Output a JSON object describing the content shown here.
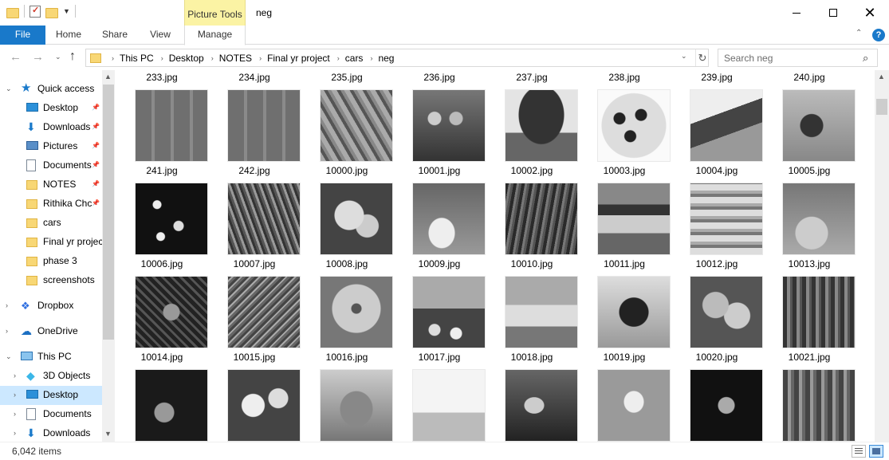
{
  "window": {
    "title": "neg",
    "contextual_tab_group": "Picture Tools",
    "minimize_icon": "minimize-icon",
    "maximize_icon": "maximize-icon",
    "close_icon": "close-icon",
    "close_glyph": "✕"
  },
  "ribbon": {
    "tabs": [
      "File",
      "Home",
      "Share",
      "View",
      "Manage"
    ],
    "active_tab": "File",
    "accent": "#1979ca",
    "help_glyph": "?",
    "collapse_glyph": "⌃"
  },
  "address": {
    "breadcrumbs": [
      "This PC",
      "Desktop",
      "NOTES",
      "Final yr project",
      "cars",
      "neg"
    ],
    "dropdown_glyph": "⌄",
    "refresh_glyph": "↻",
    "back_glyph": "←",
    "forward_glyph": "→",
    "recent_glyph": "⌄",
    "up_glyph": "↑",
    "crumb_sep_glyph": "›"
  },
  "search": {
    "placeholder": "Search neg",
    "icon_glyph": "⌕"
  },
  "navpane": {
    "pin_glyph": "📌",
    "items": [
      {
        "label": "Quick access",
        "icon": "star-icon",
        "expander": "⌄"
      },
      {
        "label": "Desktop",
        "icon": "desktop-icon",
        "pinned": true
      },
      {
        "label": "Downloads",
        "icon": "download-icon",
        "pinned": true,
        "glyph": "⬇"
      },
      {
        "label": "Pictures",
        "icon": "pictures-icon",
        "pinned": true
      },
      {
        "label": "Documents",
        "icon": "documents-icon",
        "pinned": true
      },
      {
        "label": "NOTES",
        "icon": "folder-icon",
        "pinned": true
      },
      {
        "label": "Rithika Chc",
        "icon": "folder-icon",
        "pinned": true
      },
      {
        "label": "cars",
        "icon": "folder-icon"
      },
      {
        "label": "Final yr projec",
        "icon": "folder-icon"
      },
      {
        "label": "phase 3",
        "icon": "folder-icon"
      },
      {
        "label": "screenshots",
        "icon": "folder-icon"
      },
      {
        "label": "Dropbox",
        "icon": "dropbox-icon",
        "expander": "›",
        "glyph": "❖"
      },
      {
        "label": "OneDrive",
        "icon": "onedrive-icon",
        "expander": "›",
        "glyph": "☁"
      },
      {
        "label": "This PC",
        "icon": "this-pc-icon",
        "expander": "⌄"
      },
      {
        "label": "3D Objects",
        "icon": "3d-objects-icon",
        "expander": "›",
        "glyph": "◆"
      },
      {
        "label": "Desktop",
        "icon": "desktop-icon",
        "expander": "›",
        "selected": true
      },
      {
        "label": "Documents",
        "icon": "documents-icon",
        "expander": "›"
      },
      {
        "label": "Downloads",
        "icon": "download-icon",
        "expander": "›",
        "glyph": "⬇"
      }
    ],
    "star_glyph": "★"
  },
  "files": {
    "top_labels": [
      "233.jpg",
      "234.jpg",
      "235.jpg",
      "236.jpg",
      "237.jpg",
      "238.jpg",
      "239.jpg",
      "240.jpg"
    ],
    "rows": [
      {
        "names": [
          "241.jpg",
          "242.jpg",
          "10000.jpg",
          "10001.jpg",
          "10002.jpg",
          "10003.jpg",
          "10004.jpg",
          "10005.jpg"
        ],
        "thumbs": [
          "brick-wall",
          "brick-wall",
          "fish",
          "group-photo",
          "tree-house",
          "dessert",
          "mountain",
          "bird-flower"
        ]
      },
      {
        "names": [
          "10006.jpg",
          "10007.jpg",
          "10008.jpg",
          "10009.jpg",
          "10010.jpg",
          "10011.jpg",
          "10012.jpg",
          "10013.jpg"
        ],
        "thumbs": [
          "fish-school",
          "plants",
          "flowers",
          "food-table",
          "forest",
          "burger",
          "sandwich",
          "baby"
        ]
      },
      {
        "names": [
          "10014.jpg",
          "10015.jpg",
          "10016.jpg",
          "10017.jpg",
          "10018.jpg",
          "10019.jpg",
          "10020.jpg",
          "10021.jpg"
        ],
        "thumbs": [
          "pond",
          "tree",
          "flower",
          "fruit-market",
          "hiker",
          "hummingbird",
          "leaves",
          "crowd"
        ]
      },
      {
        "names": [],
        "thumbs": [
          "dark-people",
          "daisies",
          "small-bird",
          "kids-playing",
          "flying-bird",
          "seagull",
          "stage",
          "group"
        ]
      }
    ]
  },
  "status": {
    "item_count": "6,042 items"
  }
}
